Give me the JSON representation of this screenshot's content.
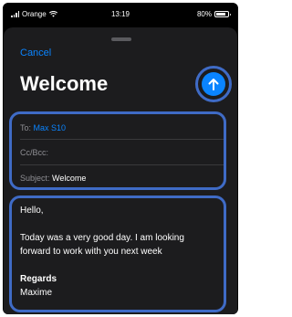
{
  "status_bar": {
    "carrier": "Orange",
    "time": "13:19",
    "battery": "80%"
  },
  "compose": {
    "cancel_label": "Cancel",
    "title": "Welcome",
    "send_icon": "arrow-up-icon",
    "fields": {
      "to_label": "To:",
      "to_value": "Max S10",
      "cc_label": "Cc/Bcc:",
      "subject_label": "Subject:",
      "subject_value": "Welcome"
    },
    "body": {
      "greeting": "Hello,",
      "line1": "Today was a very good day. I am looking",
      "line2": "forward to work with you next week",
      "closing": "Regards",
      "signature": "Maxime"
    }
  },
  "colors": {
    "accent": "#0a84ff",
    "highlight": "#3f6bc6",
    "sheet": "#1c1c1e"
  }
}
